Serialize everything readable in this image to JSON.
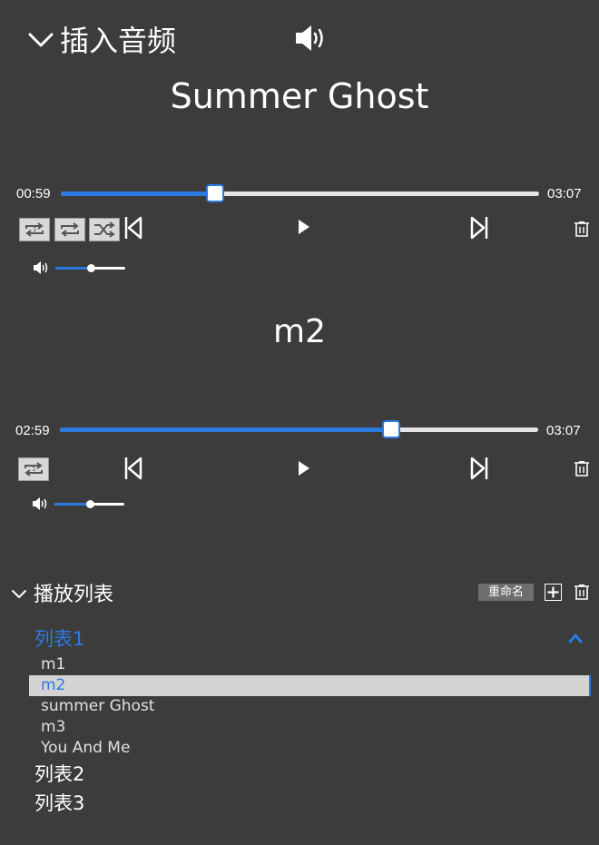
{
  "header": {
    "title": "插入音频",
    "collapse_icon": "chevron-down-icon",
    "speaker_icon": "speaker-icon"
  },
  "players": [
    {
      "track_title": "Summer Ghost",
      "elapsed": "00:59",
      "duration": "03:07",
      "progress_fraction": 0.32,
      "volume_fraction": 0.5,
      "mode_buttons": [
        "repeat-one-icon",
        "repeat-all-icon",
        "shuffle-icon"
      ]
    },
    {
      "track_title": "m2",
      "elapsed": "02:59",
      "duration": "03:07",
      "progress_fraction": 0.69,
      "volume_fraction": 0.5,
      "mode_buttons": [
        "repeat-one-icon"
      ]
    }
  ],
  "playlist": {
    "title": "播放列表",
    "rename_label": "重命名",
    "lists": [
      {
        "name": "列表1",
        "expanded": true,
        "songs": [
          "m1",
          "m2",
          "summer Ghost",
          "m3",
          "You And Me"
        ],
        "selected_song": "m2"
      },
      {
        "name": "列表2",
        "expanded": false
      },
      {
        "name": "列表3",
        "expanded": false
      }
    ]
  },
  "colors": {
    "background": "#3c3c3c",
    "accent": "#2a7ae2",
    "track": "#e6e6e6",
    "selected_row": "#d3d3d3"
  }
}
